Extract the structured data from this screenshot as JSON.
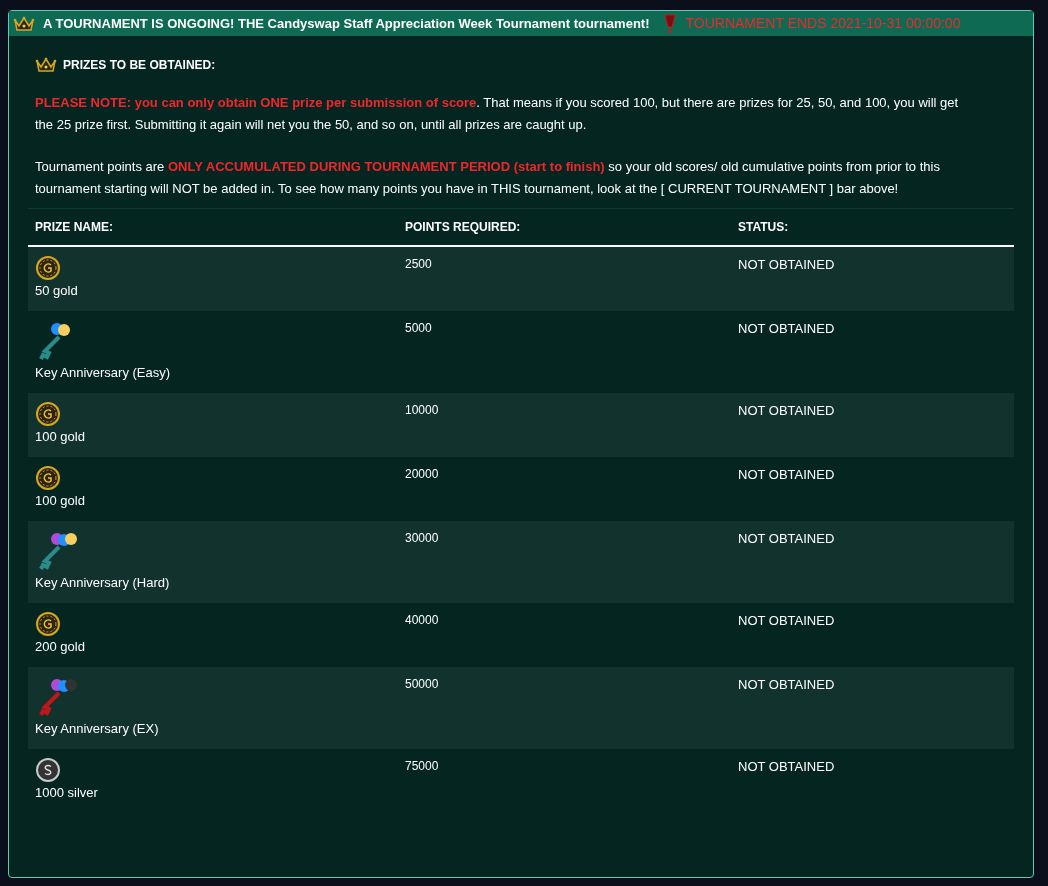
{
  "banner": {
    "title": "A TOURNAMENT IS ONGOING! THE Candyswap Staff Appreciation Week Tournament tournament!",
    "ends": "TOURNAMENT ENDS 2021-10-31 00:00:00"
  },
  "prizes_heading": "PRIZES TO BE OBTAINED:",
  "paragraphs": [
    [
      {
        "text": "PLEASE NOTE: you can only obtain ONE prize per submission of score",
        "alert": true
      },
      {
        "text": ". That means if you scored 100, but there are prizes for 25, 50, and 100, you will get the 25 prize first. Submitting it again will net you the 50, and so on, until all prizes are caught up.",
        "alert": false
      }
    ],
    [
      {
        "text": "Tournament points are ",
        "alert": false
      },
      {
        "text": "ONLY ACCUMULATED DURING TOURNAMENT PERIOD (start to finish)",
        "alert": true
      },
      {
        "text": " so your old scores/ old cumulative points from prior to this tournament starting will NOT be added in. To see how many points you have in THIS tournament, look at the [ CURRENT TOURNAMENT ] bar above!",
        "alert": false
      }
    ]
  ],
  "table": {
    "columns": [
      "PRIZE NAME:",
      "POINTS REQUIRED:",
      "STATUS:"
    ],
    "rows": [
      {
        "kind": "gold",
        "prize": "50 gold",
        "points": "2500",
        "status": "NOT OBTAINED"
      },
      {
        "kind": "key_easy",
        "prize": "Key Anniversary (Easy)",
        "points": "5000",
        "status": "NOT OBTAINED"
      },
      {
        "kind": "gold",
        "prize": "100 gold",
        "points": "10000",
        "status": "NOT OBTAINED"
      },
      {
        "kind": "gold",
        "prize": "100 gold",
        "points": "20000",
        "status": "NOT OBTAINED"
      },
      {
        "kind": "key_hard",
        "prize": "Key Anniversary (Hard)",
        "points": "30000",
        "status": "NOT OBTAINED"
      },
      {
        "kind": "gold",
        "prize": "200 gold",
        "points": "40000",
        "status": "NOT OBTAINED"
      },
      {
        "kind": "key_ex",
        "prize": "Key Anniversary (EX)",
        "points": "50000",
        "status": "NOT OBTAINED"
      },
      {
        "kind": "silver",
        "prize": "1000 silver",
        "points": "75000",
        "status": "NOT OBTAINED"
      }
    ]
  }
}
